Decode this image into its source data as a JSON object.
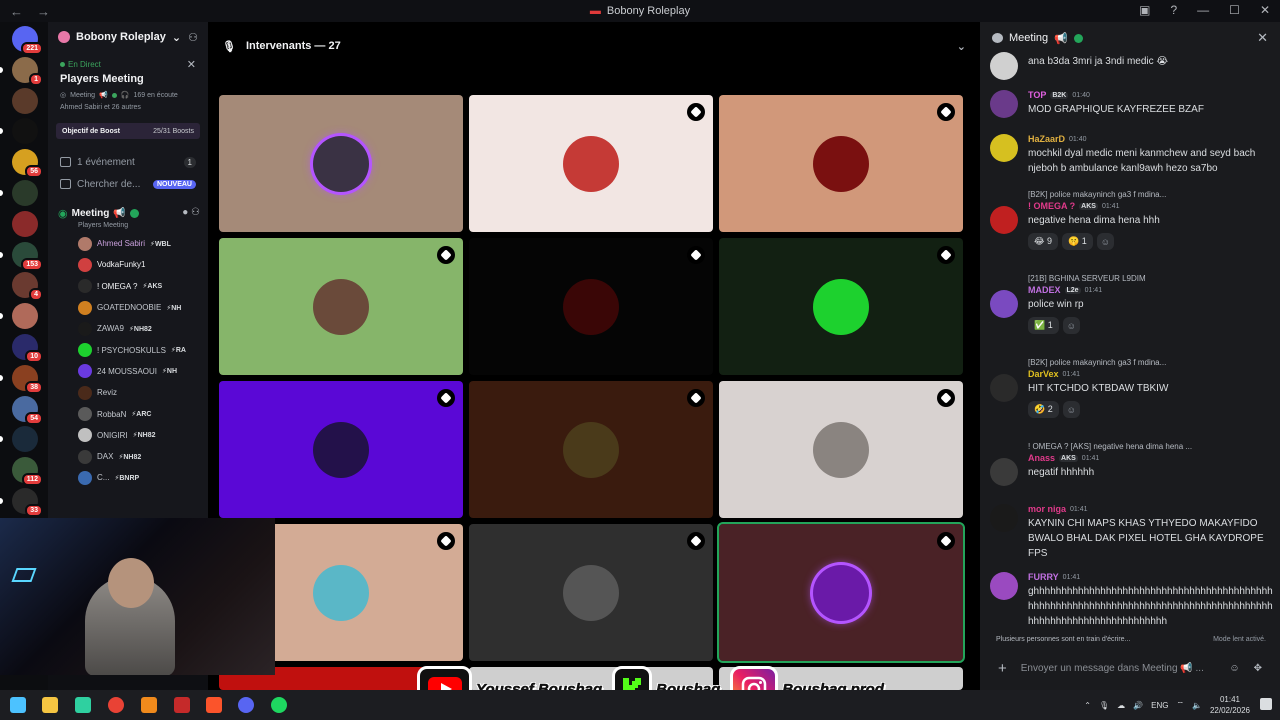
{
  "window": {
    "title": "Bobony Roleplay",
    "nav_back": "←",
    "nav_forward": "→"
  },
  "rail": {
    "badges": [
      "221",
      "1",
      "56",
      "153",
      "4",
      "10",
      "38",
      "54",
      "112",
      "33"
    ]
  },
  "sidebar": {
    "server_name": "Bobony Roleplay",
    "live": {
      "label": "En Direct",
      "title": "Players Meeting",
      "channel": "Meeting",
      "listeners": "169 en écoute",
      "attendees": "Ahmed Sabiri et 26 autres"
    },
    "boost": {
      "label": "Objectif de Boost",
      "count": "25/31 Boosts"
    },
    "events": {
      "label": "1 événement",
      "count": "1"
    },
    "search": {
      "label": "Chercher de...",
      "badge": "NOUVEAU"
    },
    "voice_channel": {
      "name": "Meeting",
      "subtitle": "Players Meeting",
      "members": [
        {
          "name": "Ahmed Sabiri",
          "tag": "WBL",
          "color": "#c9a0dc"
        },
        {
          "name": "VodkaFunky1",
          "tag": "",
          "color": "#f2f3f5"
        },
        {
          "name": "! OMEGA ?",
          "tag": "AKS",
          "color": "#f2f3f5"
        },
        {
          "name": "GOATEDNOOBIE",
          "tag": "NH",
          "color": "#c4c8ce"
        },
        {
          "name": "ZAWA9",
          "tag": "NH82",
          "color": "#c4c8ce"
        },
        {
          "name": "! PSYCHOSKULLS",
          "tag": "RA",
          "color": "#c4c8ce"
        },
        {
          "name": "24 MOUSSAOUI",
          "tag": "NH",
          "color": "#c4c8ce"
        },
        {
          "name": "Reviz",
          "tag": "",
          "color": "#c4c8ce"
        },
        {
          "name": "RobbaN",
          "tag": "ARC",
          "color": "#c4c8ce"
        },
        {
          "name": "ONIGIRI",
          "tag": "NH82",
          "color": "#c4c8ce"
        },
        {
          "name": "DAX",
          "tag": "NH82",
          "color": "#c4c8ce"
        },
        {
          "name": "C...",
          "tag": "BNRP",
          "color": "#c4c8ce"
        }
      ]
    }
  },
  "stage": {
    "header": "Intervenants — 27",
    "tiles": [
      {
        "bg": "#a58a78",
        "avatar": "#3a3244",
        "badge": false
      },
      {
        "bg": "#f2e6e3",
        "avatar": "#c53a36",
        "badge": true
      },
      {
        "bg": "#d1987a",
        "avatar": "#7a1010",
        "badge": true
      },
      {
        "bg": "#86b56a",
        "avatar": "#6a4a3a",
        "badge": true
      },
      {
        "bg": "#050505",
        "avatar": "#3a0606",
        "badge": true
      },
      {
        "bg": "#122012",
        "avatar": "#1dd12e",
        "badge": true
      },
      {
        "bg": "#5a08d6",
        "avatar": "#23114a",
        "badge": true
      },
      {
        "bg": "#3a1b0e",
        "avatar": "#4a3a1a",
        "badge": true
      },
      {
        "bg": "#d8d2d0",
        "avatar": "#8a8480",
        "badge": true
      },
      {
        "bg": "#d3ab95",
        "avatar": "#5ab7c7",
        "badge": true
      },
      {
        "bg": "#2f2f2f",
        "avatar": "#555555",
        "badge": true
      },
      {
        "bg": "#4a2226",
        "avatar": "#6a1aa8",
        "badge": true
      }
    ]
  },
  "chat": {
    "title": "Meeting",
    "messages": [
      {
        "author": "",
        "time": "",
        "text": "ana b3da 3mri ja 3ndi medic 😭",
        "color": "#f2f3f5"
      },
      {
        "author": "TOP",
        "chip": "B2K",
        "time": "01:40",
        "text": "MOD GRAPHIQUE KAYFREZEE BZAF",
        "color": "#e060e0"
      },
      {
        "author": "HaZaarD",
        "time": "01:40",
        "text": "mochkil dyal  medic meni kanmchew and seyd bach njeboh b ambulance kanl9awh hezo sa7bo",
        "color": "#e0b040"
      },
      {
        "reply_chip": "B2K",
        "reply": "police makayninch ga3 f mdina...",
        "author": "! OMEGA ?",
        "chip": "AKS",
        "time": "01:41",
        "text": "negative hena dima hena hhh",
        "color": "#e03a8a",
        "reactions": [
          {
            "emoji": "😂",
            "count": "9"
          },
          {
            "emoji": "🤫",
            "count": "1"
          }
        ]
      },
      {
        "reply_chip": "21B",
        "reply": "BGHINA SERVEUR L9DIM",
        "author": "MADEX",
        "chip": "L2e",
        "time": "01:41",
        "text": "police win rp",
        "color": "#c070e0",
        "reactions": [
          {
            "emoji": "✅",
            "count": "1"
          }
        ]
      },
      {
        "reply_chip": "B2K",
        "reply": "police makayninch ga3 f mdina...",
        "author": "DarVex",
        "time": "01:41",
        "text": "HIT KTCHDO KTBDAW TBKIW",
        "color": "#e0c020",
        "reactions": [
          {
            "emoji": "🤣",
            "count": "2"
          }
        ]
      },
      {
        "reply_chip": "AKS",
        "reply": "negative hena dima hena ...",
        "reply_author": "! OMEGA ?",
        "author": "Anass",
        "chip": "AKS",
        "time": "01:41",
        "text": "negatif hhhhhh",
        "color": "#e03a8a"
      },
      {
        "author": "mor niga",
        "time": "01:41",
        "text": "KAYNIN CHI MAPS KHAS YTHYEDO MAKAYFIDO BWALO BHAL DAK PIXEL HOTEL GHA KAYDROPE FPS",
        "color": "#e03a8a"
      },
      {
        "author": "FURRY",
        "time": "01:41",
        "text": "ghhhhhhhhhhhhhhhhhhhhhhhhhhhhhhhhhhhhhhhhhhhhhhhhhhhhhhhhhhhhhhhhhhhhhhhhhhhhhhhhhhhhhhhhhhhhhhhhhhhhhhhhhhhhhhhh",
        "color": "#c070e0"
      }
    ],
    "typing": "Plusieurs personnes sont en train d'écrire...",
    "slow_mode": "Mode lent activé.",
    "composer_placeholder": "Envoyer un message dans Meeting 📢 ..."
  },
  "social": {
    "youtube": "Youssef Boushaq",
    "kick": "Boushaq",
    "instagram": "Boushaq.prod"
  },
  "taskbar": {
    "lang": "ENG",
    "time": "01:41",
    "date": "22/02/2026"
  }
}
